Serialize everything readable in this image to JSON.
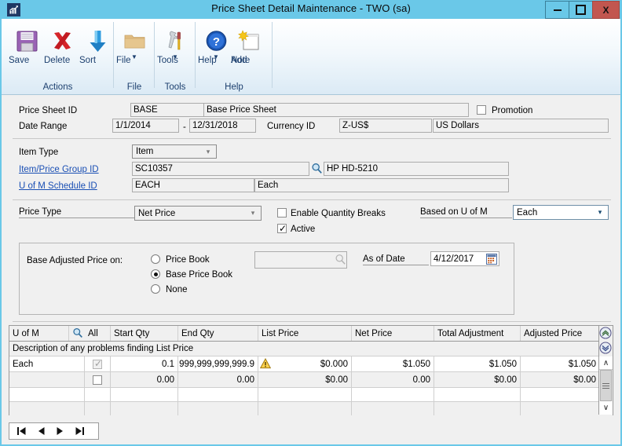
{
  "window": {
    "title": "Price Sheet Detail Maintenance  -  TWO (sa)",
    "app_icon": "chart-icon",
    "minimize_label": "Minimize",
    "maximize_label": "Maximize",
    "close_label": "X"
  },
  "ribbon": {
    "groups": [
      {
        "name": "Actions",
        "buttons": [
          {
            "label": "Save",
            "icon": "save-floppy-icon",
            "caret": ""
          },
          {
            "label": "Delete",
            "icon": "delete-x-icon",
            "caret": ""
          },
          {
            "label": "Sort",
            "icon": "sort-down-arrow-icon",
            "caret": ""
          }
        ]
      },
      {
        "name": "File",
        "buttons": [
          {
            "label": "File",
            "icon": "folder-icon",
            "caret": "▼"
          }
        ]
      },
      {
        "name": "Tools",
        "buttons": [
          {
            "label": "Tools",
            "icon": "tools-wrench-icon",
            "caret": "▼"
          }
        ]
      },
      {
        "name": "Help",
        "buttons": [
          {
            "label": "Help",
            "icon": "help-question-icon",
            "caret": "▼"
          },
          {
            "label": "Add\nNote",
            "label_line1": "Add",
            "label_line2": "Note",
            "icon": "add-note-icon",
            "caret": ""
          }
        ]
      }
    ]
  },
  "header": {
    "price_sheet_id_label": "Price Sheet ID",
    "price_sheet_id_value": "BASE",
    "price_sheet_desc_value": "Base Price Sheet",
    "promotion_label": "Promotion",
    "promotion_checked": false,
    "date_range_label": "Date Range",
    "date_from": "1/1/2014",
    "date_sep": "-",
    "date_to": "12/31/2018",
    "currency_id_label": "Currency ID",
    "currency_id_value": "Z-US$",
    "currency_desc_value": "US Dollars"
  },
  "item": {
    "item_type_label": "Item Type",
    "item_type_value": "Item",
    "item_group_label": "Item/Price Group ID",
    "item_group_value": "SC10357",
    "item_group_desc": "HP HD-5210",
    "lookup_icon": "magnifier-lookup-icon",
    "uom_schedule_label": "U of M Schedule ID",
    "uom_schedule_value": "EACH",
    "uom_schedule_desc": "Each"
  },
  "pricing": {
    "price_type_label": "Price Type",
    "price_type_value": "Net Price",
    "enable_qty_breaks_label": "Enable Quantity Breaks",
    "enable_qty_breaks_checked": false,
    "active_label": "Active",
    "active_checked": true,
    "based_on_uom_label": "Based on U of M",
    "based_on_uom_value": "Each"
  },
  "base_adjusted": {
    "title": "Base Adjusted Price on:",
    "options": [
      {
        "label": "Price Book",
        "selected": false
      },
      {
        "label": "Base Price Book",
        "selected": true
      },
      {
        "label": "None",
        "selected": false
      }
    ],
    "price_book_value": "",
    "price_book_lookup_icon": "magnifier-lookup-icon",
    "as_of_date_label": "As of Date",
    "as_of_date_value": "4/12/2017",
    "calendar_icon": "calendar-icon"
  },
  "grid": {
    "lookup_icon": "magnifier-lookup-icon",
    "columns": [
      "U of M",
      "All",
      "Start Qty",
      "End Qty",
      "List Price",
      "Net Price",
      "Total Adjustment",
      "Adjusted Price"
    ],
    "description_row": "Description of any problems finding List Price",
    "rows": [
      {
        "uom": "Each",
        "all_checked": true,
        "all_disabled": true,
        "start_qty": "0.1",
        "end_qty": "999,999,999,999.9",
        "list_price": "$0.000",
        "list_price_warning": true,
        "warning_icon": "warning-triangle-icon",
        "net_price": "$1.050",
        "total_adjustment": "$1.050",
        "adjusted_price": "$1.050"
      },
      {
        "uom": "",
        "all_checked": false,
        "all_disabled": false,
        "start_qty": "0.00",
        "end_qty": "0.00",
        "list_price": "$0.00",
        "list_price_warning": false,
        "net_price": "0.00",
        "total_adjustment": "$0.00",
        "adjusted_price": "$0.00"
      },
      {
        "uom": "",
        "all_checked": null,
        "start_qty": "",
        "end_qty": "",
        "list_price": "",
        "net_price": "",
        "total_adjustment": "",
        "adjusted_price": ""
      },
      {
        "uom": "",
        "all_checked": null,
        "start_qty": "",
        "end_qty": "",
        "list_price": "",
        "net_price": "",
        "total_adjustment": "",
        "adjusted_price": ""
      }
    ],
    "scroll": {
      "roll_up_icon": "roll-up-icon",
      "roll_down_icon": "roll-down-icon",
      "up_arrow": "∧",
      "down_arrow": "∨"
    }
  },
  "navigation": {
    "first_label": "First record",
    "previous_label": "Previous record",
    "next_label": "Next record",
    "last_label": "Last record"
  },
  "colors": {
    "titlebar": "#6ac8e8",
    "close_button": "#c2564f",
    "panel": "#f0f0f0",
    "link": "#1a4fb4",
    "ribbon_text": "#1c3f6e",
    "warning": "#ffd24d"
  }
}
